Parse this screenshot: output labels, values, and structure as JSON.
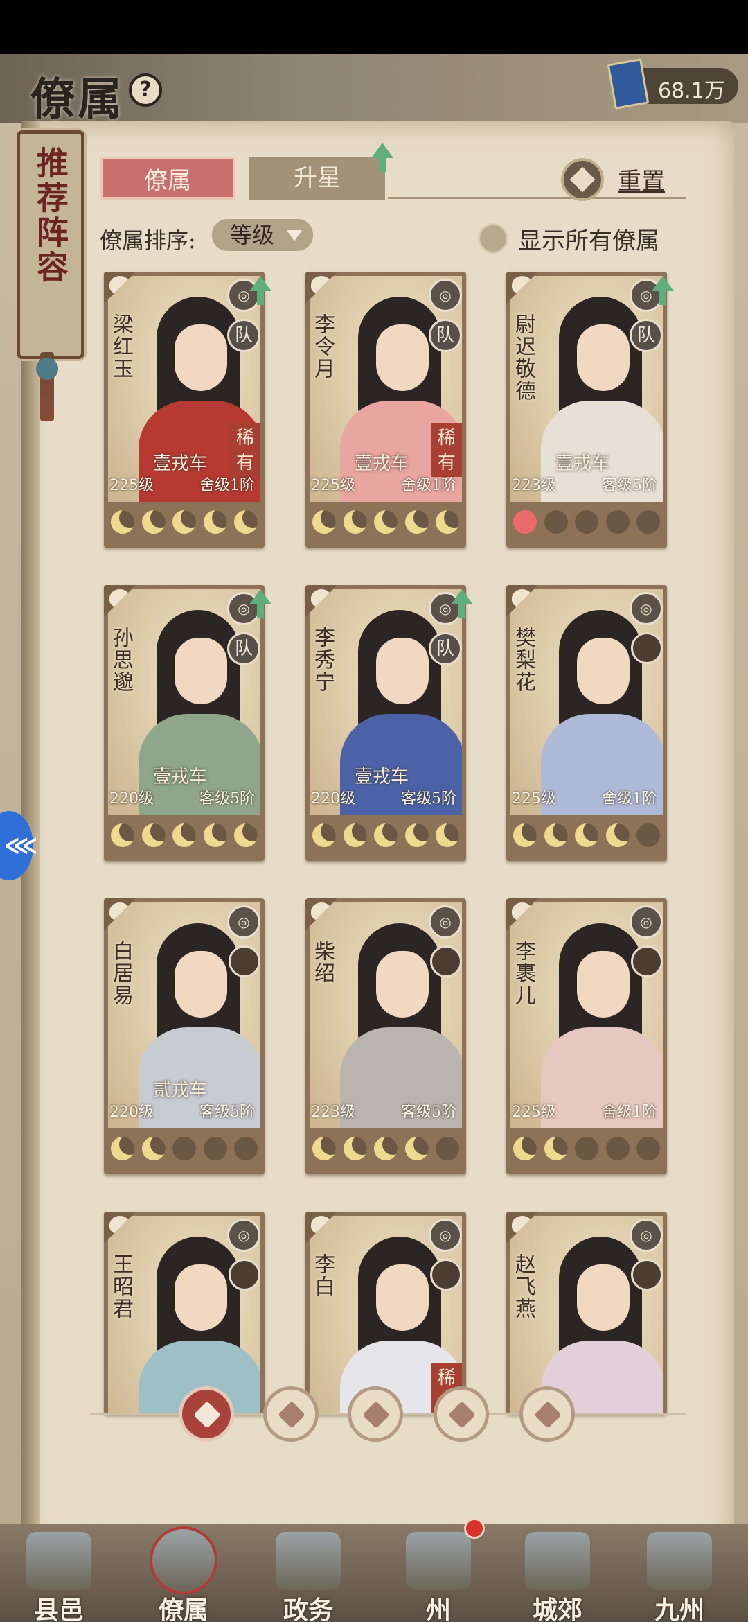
{
  "header": {
    "title": "僚属",
    "currency": "68.1万"
  },
  "recommend": {
    "label": "推荐阵容"
  },
  "tabs": [
    {
      "label": "僚属"
    },
    {
      "label": "升星"
    }
  ],
  "reset": {
    "label": "重置"
  },
  "sort": {
    "label": "僚属排序:",
    "value": "等级"
  },
  "show_all": {
    "label": "显示所有僚属"
  },
  "colors": {
    "accent_red": "#a8423b",
    "upgrade_green": "#5fae7c",
    "moon_gold": "#efd98f"
  },
  "cards": [
    {
      "name": "梁红玉",
      "rank": "壹戎车",
      "level": "225级",
      "grade": "舍级1阶",
      "team": "队",
      "rare": "稀有",
      "moons": 5
    },
    {
      "name": "李令月",
      "rank": "壹戎车",
      "level": "225级",
      "grade": "舍级1阶",
      "team": "队",
      "rare": "稀有",
      "moons": 5
    },
    {
      "name": "尉迟敬德",
      "rank": "壹戎车",
      "level": "223级",
      "grade": "客级5阶",
      "team": "队",
      "rare": "",
      "moons": 0
    },
    {
      "name": "孙思邈",
      "rank": "壹戎车",
      "level": "220级",
      "grade": "客级5阶",
      "team": "队",
      "rare": "",
      "moons": 5
    },
    {
      "name": "李秀宁",
      "rank": "壹戎车",
      "level": "220级",
      "grade": "客级5阶",
      "team": "队",
      "rare": "",
      "moons": 5
    },
    {
      "name": "樊梨花",
      "rank": "",
      "level": "225级",
      "grade": "舍级1阶",
      "team": "",
      "rare": "",
      "moons": 4
    },
    {
      "name": "白居易",
      "rank": "贰戎车",
      "level": "220级",
      "grade": "客级5阶",
      "team": "",
      "rare": "",
      "moons": 2
    },
    {
      "name": "柴绍",
      "rank": "",
      "level": "223级",
      "grade": "客级5阶",
      "team": "",
      "rare": "",
      "moons": 4
    },
    {
      "name": "李裹儿",
      "rank": "",
      "level": "225级",
      "grade": "舍级1阶",
      "team": "",
      "rare": "",
      "moons": 2
    },
    {
      "name": "王昭君",
      "rank": "",
      "level": "",
      "grade": "",
      "team": "",
      "rare": "",
      "moons": 0
    },
    {
      "name": "李白",
      "rank": "",
      "level": "",
      "grade": "",
      "team": "",
      "rare": "稀",
      "moons": 0
    },
    {
      "name": "赵飞燕",
      "rank": "",
      "level": "",
      "grade": "",
      "team": "",
      "rare": "",
      "moons": 0
    }
  ],
  "nav": [
    {
      "label": "县邑"
    },
    {
      "label": "僚属"
    },
    {
      "label": "政务"
    },
    {
      "label": "州"
    },
    {
      "label": "城郊"
    },
    {
      "label": "九州"
    }
  ]
}
